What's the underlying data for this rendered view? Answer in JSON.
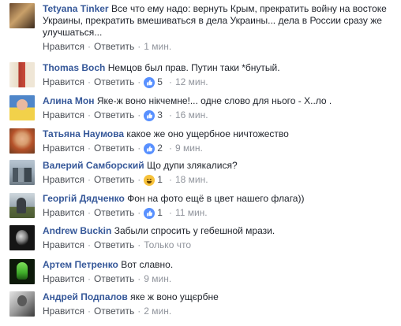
{
  "ui": {
    "like_label": "Нравится",
    "reply_label": "Ответить",
    "dot": "·"
  },
  "comments": [
    {
      "author": "Tetyana Tinker",
      "text": "Все что ему надо: вернуть Крым, прекратить войну на востоке Украины, прекратить вмешиваться в дела Украины... дела в России сразу же улучшаться...",
      "reaction": null,
      "count": "",
      "time": "1 мин."
    },
    {
      "author": "Thomas Boch",
      "text": "Немцов был прав. Путин таки *бнутый.",
      "reaction": "like",
      "count": "5",
      "time": "12 мин."
    },
    {
      "author": "Алина Мон",
      "text": "Яке-ж воно нікчемне!... одне слово для нього - Х..ло .",
      "reaction": "like",
      "count": "3",
      "time": "16 мин."
    },
    {
      "author": "Татьяна Наумова",
      "text": "какое же оно ущербное ничтожество",
      "reaction": "like",
      "count": "2",
      "time": "9 мин."
    },
    {
      "author": "Валерий Самборский",
      "text": "Що дупи злякалися?",
      "reaction": "haha",
      "count": "1",
      "time": "18 мин."
    },
    {
      "author": "Георгій Дядченко",
      "text": "Фон на фото ещё в цвет нашего флага))",
      "reaction": "like",
      "count": "1",
      "time": "11 мин."
    },
    {
      "author": "Andrew Buckin",
      "text": "Забыли спросить у гебешной мрази.",
      "reaction": null,
      "count": "",
      "time": "Только что"
    },
    {
      "author": "Артем Петренко",
      "text": "Вот славно.",
      "reaction": null,
      "count": "",
      "time": "9 мин."
    },
    {
      "author": "Андрей Подпалов",
      "text": "яке ж воно ущєрбне",
      "reaction": null,
      "count": "",
      "time": "2 мин."
    }
  ]
}
